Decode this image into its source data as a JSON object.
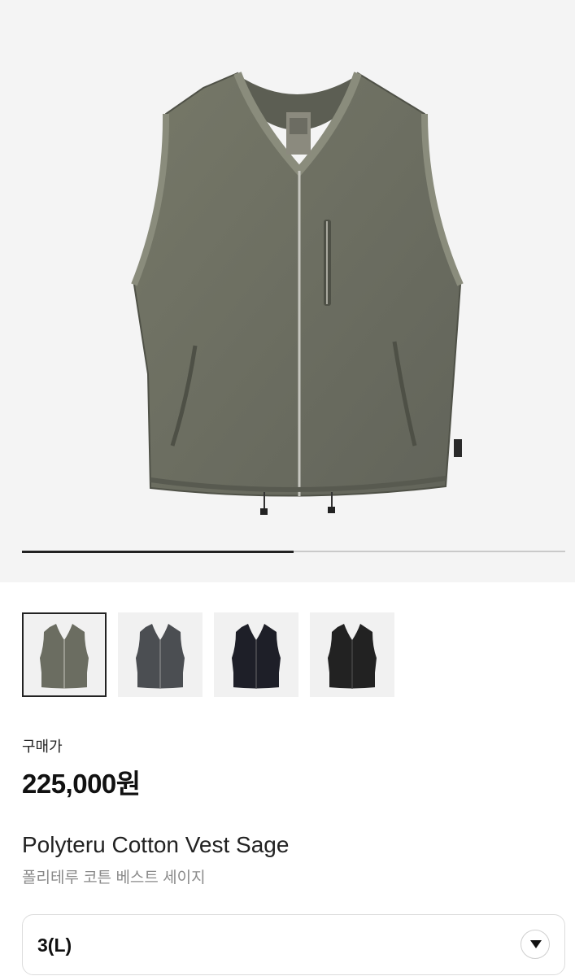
{
  "gallery": {
    "progress": 0.5,
    "images": [
      {
        "icon": "vest-sage-image",
        "color": "#6b6d61",
        "selected": true
      },
      {
        "icon": "vest-charcoal-image",
        "color": "#4b4e52",
        "selected": false
      },
      {
        "icon": "vest-navy-image",
        "color": "#1e1f28",
        "selected": false
      },
      {
        "icon": "vest-black-image",
        "color": "#222222",
        "selected": false
      }
    ]
  },
  "product": {
    "price_label": "구매가",
    "price": "225,000원",
    "name_en": "Polyteru Cotton Vest Sage",
    "name_ko": "폴리테루 코튼 베스트 세이지"
  },
  "size_select": {
    "value": "3(L)",
    "icon": "dropdown-arrow-icon"
  }
}
